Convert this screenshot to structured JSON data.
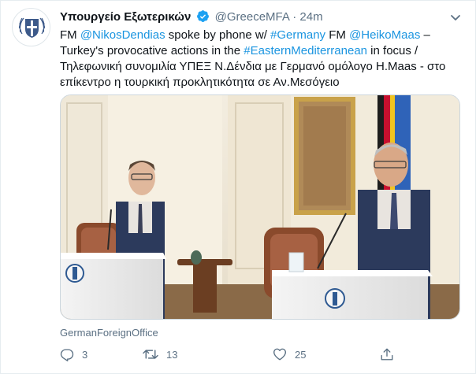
{
  "account": {
    "name": "Υπουργείο Εξωτερικών",
    "handle": "@GreeceMFA",
    "separator": "·",
    "time": "24m"
  },
  "tweet": {
    "segments": [
      {
        "text": "FM ",
        "type": "text"
      },
      {
        "text": "@NikosDendias",
        "type": "link"
      },
      {
        "text": " spoke by phone w/ ",
        "type": "text"
      },
      {
        "text": "#Germany",
        "type": "link"
      },
      {
        "text": " FM ",
        "type": "text"
      },
      {
        "text": "@HeikoMaas",
        "type": "link"
      },
      {
        "text": " – Turkey's provocative actions in the ",
        "type": "text"
      },
      {
        "text": "#EasternMediterranean",
        "type": "link"
      },
      {
        "text": " in focus / Τηλεφωνική συνομιλία ΥΠΕΞ Ν.Δένδια με Γερμανό ομόλογο Η.Maas - στο επίκεντρο η τουρκική προκλητικότητα σε Αν.Μεσόγειο",
        "type": "text"
      }
    ]
  },
  "media": {
    "credit": "GermanForeignOffice"
  },
  "actions": {
    "reply_count": "3",
    "retweet_count": "13",
    "like_count": "25"
  },
  "icons": {
    "avatar": "greek-coat-of-arms-icon",
    "verified": "verified-badge-icon",
    "more": "chevron-down-icon",
    "reply": "reply-icon",
    "retweet": "retweet-icon",
    "like": "heart-icon",
    "share": "share-icon"
  },
  "colors": {
    "link": "#1b95e0",
    "muted": "#5b7083",
    "verified": "#1da1f2"
  }
}
